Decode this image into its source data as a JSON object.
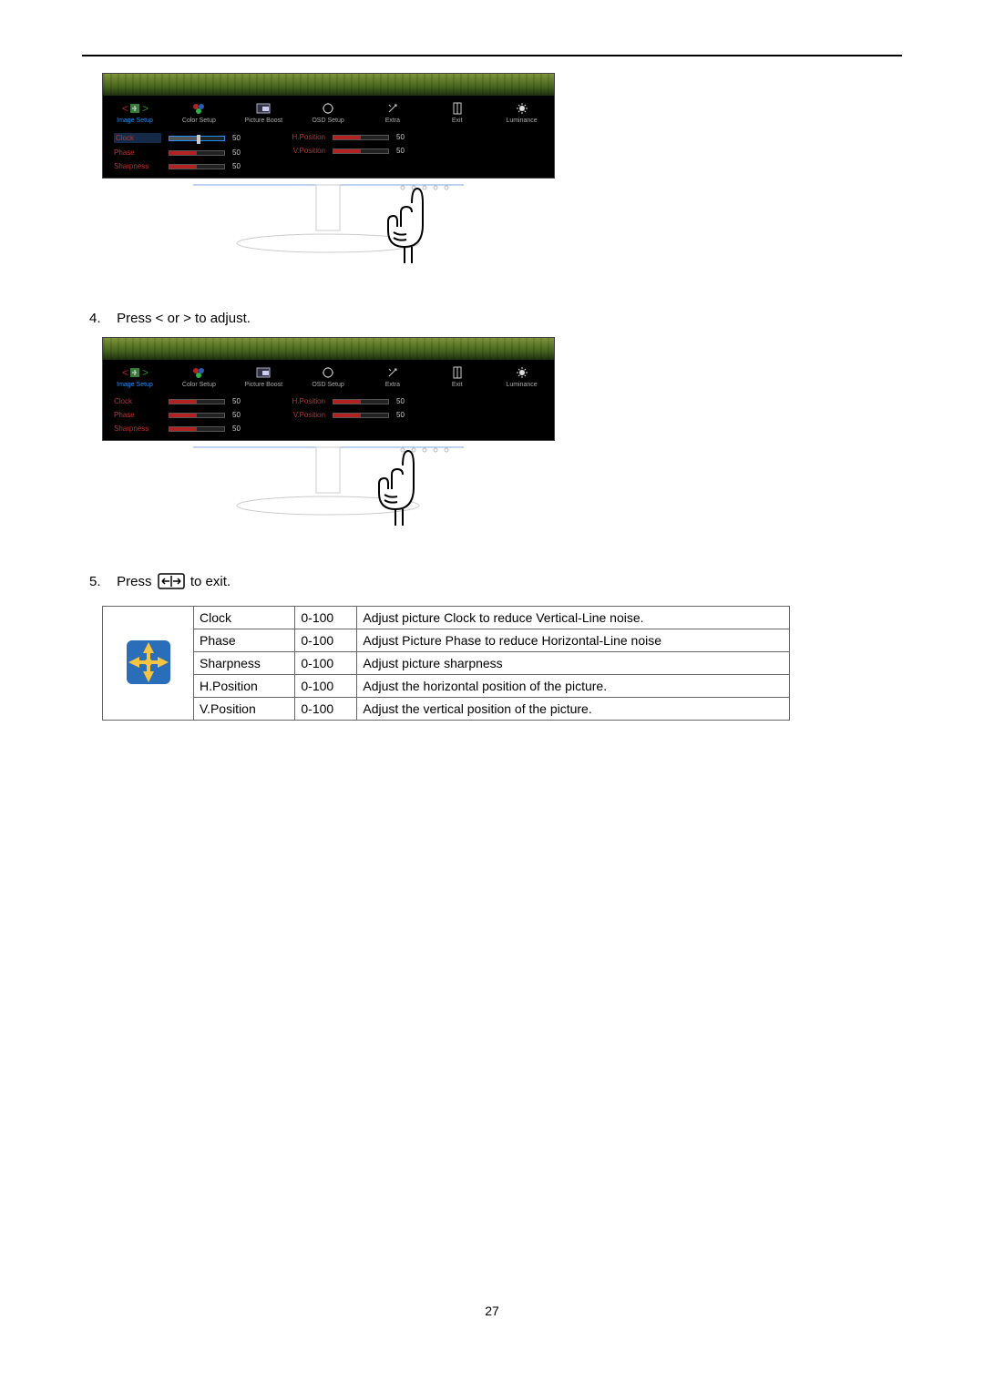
{
  "page_number": "27",
  "osd": {
    "tabs": [
      {
        "label": "Image Setup",
        "active": true
      },
      {
        "label": "Color Setup"
      },
      {
        "label": "Picture Boost"
      },
      {
        "label": "OSD Setup"
      },
      {
        "label": "Extra"
      },
      {
        "label": "Exit"
      },
      {
        "label": "Luminance"
      }
    ],
    "slidersA_leftcol": [
      {
        "label": "Clock",
        "value": "50",
        "highlight": true
      },
      {
        "label": "Phase",
        "value": "50"
      },
      {
        "label": "Sharpness",
        "value": "50"
      }
    ],
    "slidersA_rightcol": [
      {
        "label": "H.Position",
        "value": "50"
      },
      {
        "label": "V.Position",
        "value": "50"
      }
    ],
    "slidersB_leftcol": [
      {
        "label": "Clock",
        "value": "50"
      },
      {
        "label": "Phase",
        "value": "50"
      },
      {
        "label": "Sharpness",
        "value": "50"
      }
    ],
    "slidersB_rightcol": [
      {
        "label": "H.Position",
        "value": "50"
      },
      {
        "label": "V.Position",
        "value": "50"
      }
    ]
  },
  "instructions": {
    "step4_num": "4.",
    "step4_text": "Press < or > to adjust.",
    "step5_num": "5.",
    "step5_prefix": "Press ",
    "step5_suffix": " to exit."
  },
  "table": {
    "rows": [
      {
        "name": "Clock",
        "range": "0-100",
        "desc": "Adjust picture Clock to reduce Vertical-Line noise."
      },
      {
        "name": "Phase",
        "range": "0-100",
        "desc": "Adjust Picture Phase to reduce Horizontal-Line noise"
      },
      {
        "name": "Sharpness",
        "range": "0-100",
        "desc": "Adjust picture sharpness"
      },
      {
        "name": "H.Position",
        "range": "0-100",
        "desc": "Adjust the horizontal position of the picture."
      },
      {
        "name": "V.Position",
        "range": "0-100",
        "desc": "Adjust the vertical position of the picture."
      }
    ]
  }
}
